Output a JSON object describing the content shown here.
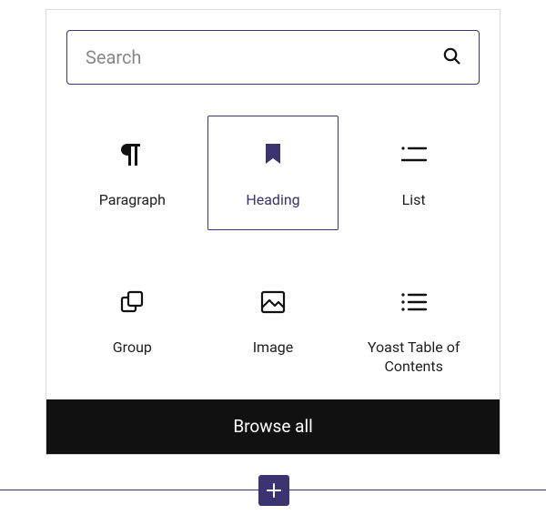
{
  "search": {
    "placeholder": "Search"
  },
  "blocks": [
    {
      "label": "Paragraph"
    },
    {
      "label": "Heading"
    },
    {
      "label": "List"
    },
    {
      "label": "Group"
    },
    {
      "label": "Image"
    },
    {
      "label": "Yoast Table of Contents"
    }
  ],
  "footer": {
    "browse_all": "Browse all"
  }
}
